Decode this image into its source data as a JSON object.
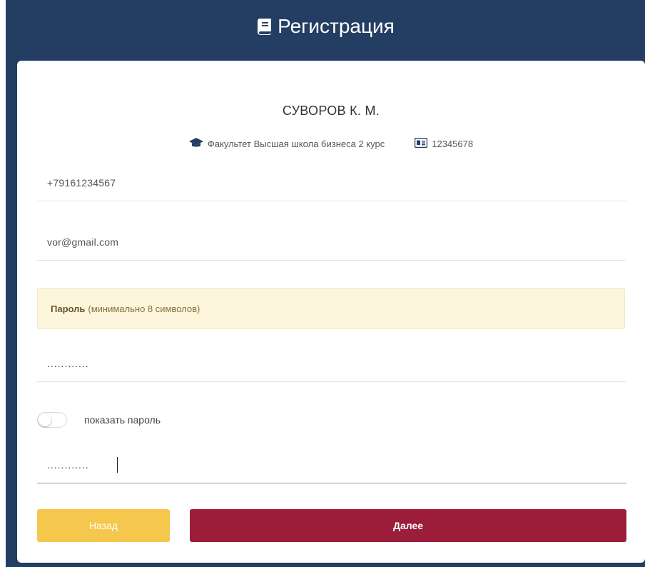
{
  "header": {
    "title": "Регистрация",
    "icon": "book-icon",
    "background": "#233d63"
  },
  "student": {
    "name": "СУВОРОВ К. М.",
    "faculty_icon": "graduation-cap-icon",
    "faculty": "Факультет Высшая школа бизнеса 2 курс",
    "id_icon": "id-card-icon",
    "id_number": "12345678"
  },
  "form": {
    "phone_value": "+79161234567",
    "email_value": "vor@gmail.com",
    "password_notice_bold": "Пароль",
    "password_notice_text": "(минимально 8 символов)",
    "password_value": "............",
    "show_password_label": "показать пароль",
    "show_password_on": false,
    "password_confirm_value": "............"
  },
  "buttons": {
    "back_label": "Назад",
    "next_label": "Далее",
    "back_color": "#f6c74d",
    "next_color": "#9b1d3a"
  }
}
